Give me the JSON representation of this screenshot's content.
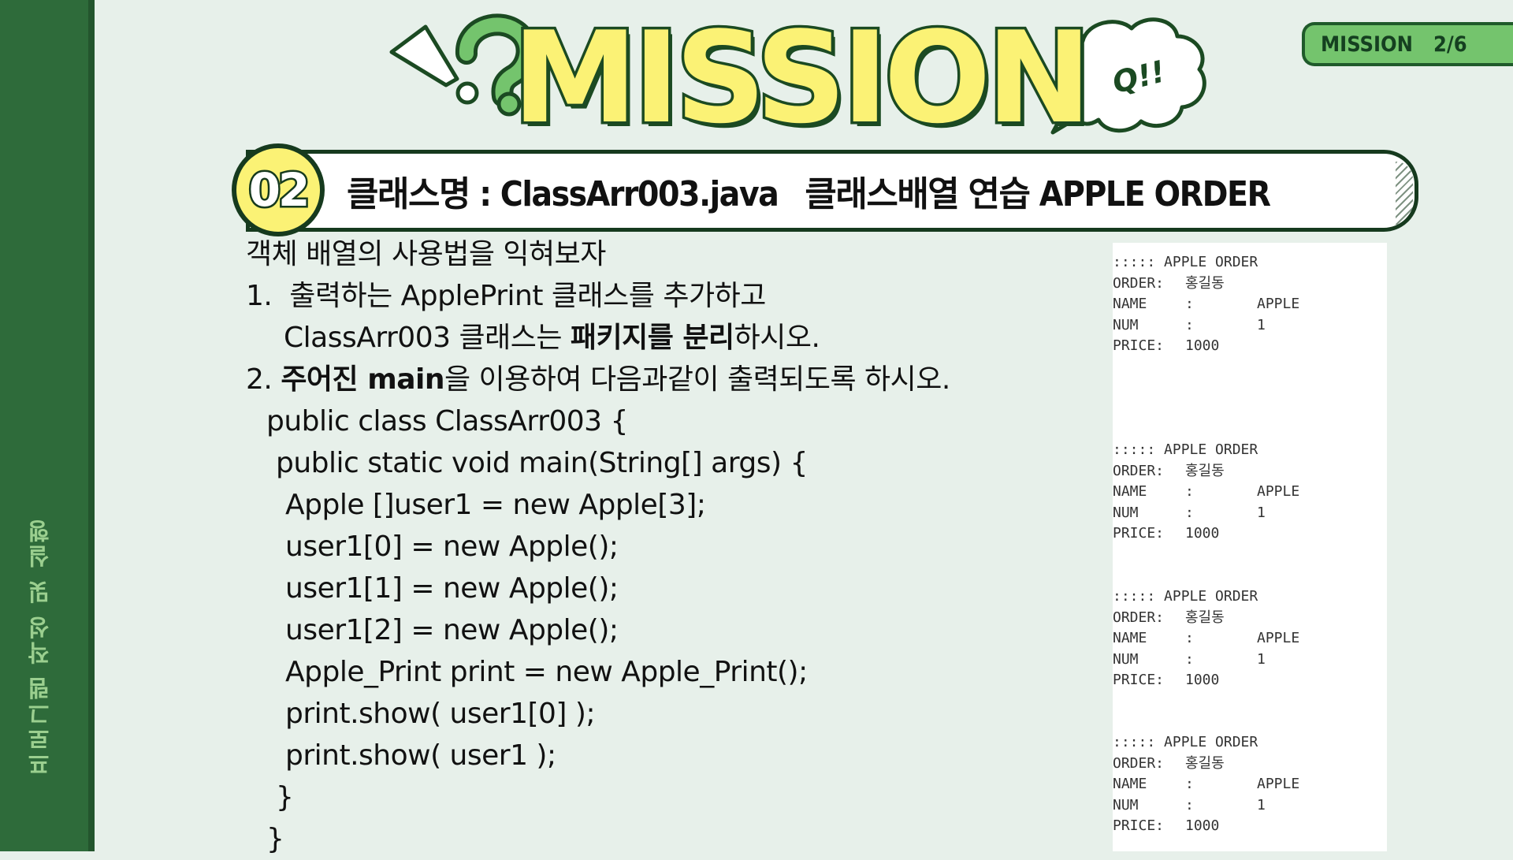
{
  "sidebar": {
    "label": "프로그램 작성 및 실행"
  },
  "badge": {
    "mission": "MISSION",
    "page": "2/6"
  },
  "title": {
    "word": "MISSION",
    "bubble": "Q!!"
  },
  "header": {
    "number": "02",
    "classname": "클래스명 : ClassArr003.java",
    "topic": "클래스배열  연습 APPLE ORDER"
  },
  "instructions": {
    "line1": "객체 배열의 사용법을 익혀보자",
    "item1_num": "1.",
    "item1_a": "출력하는 ApplePrint 클래스를 추가하고",
    "item1_b_pre": "ClassArr003 클래스는 ",
    "item1_b_bold": "패키지를 분리",
    "item1_b_post": "하시오.",
    "item2_num": "2.",
    "item2_bold": "주어진 main",
    "item2_post": "을 이용하여 다음과같이 출력되도록 하시오."
  },
  "code": [
    "public class ClassArr003 {",
    "public static void main(String[] args) {",
    "Apple []user1 = new Apple[3];",
    "user1[0] = new Apple();",
    "user1[1] = new Apple();",
    "user1[2] = new Apple();",
    "Apple_Print print = new Apple_Print();",
    "print.show( user1[0] );",
    "print.show( user1 );",
    "}",
    "}"
  ],
  "console": {
    "header": "::::: APPLE ORDER",
    "order_label": "ORDER:",
    "order_value": "홍길동",
    "name_label": "NAME",
    "colon": ":",
    "name_value": "APPLE",
    "num_label": "NUM",
    "num_value": "1",
    "price_label": "PRICE:",
    "price_value": "1000"
  },
  "colors": {
    "sidebar": "#2e6b3a",
    "background": "#e7f0ea",
    "accent_yellow": "#fbf275",
    "accent_green": "#74c46d",
    "dark_green": "#163a1e"
  }
}
